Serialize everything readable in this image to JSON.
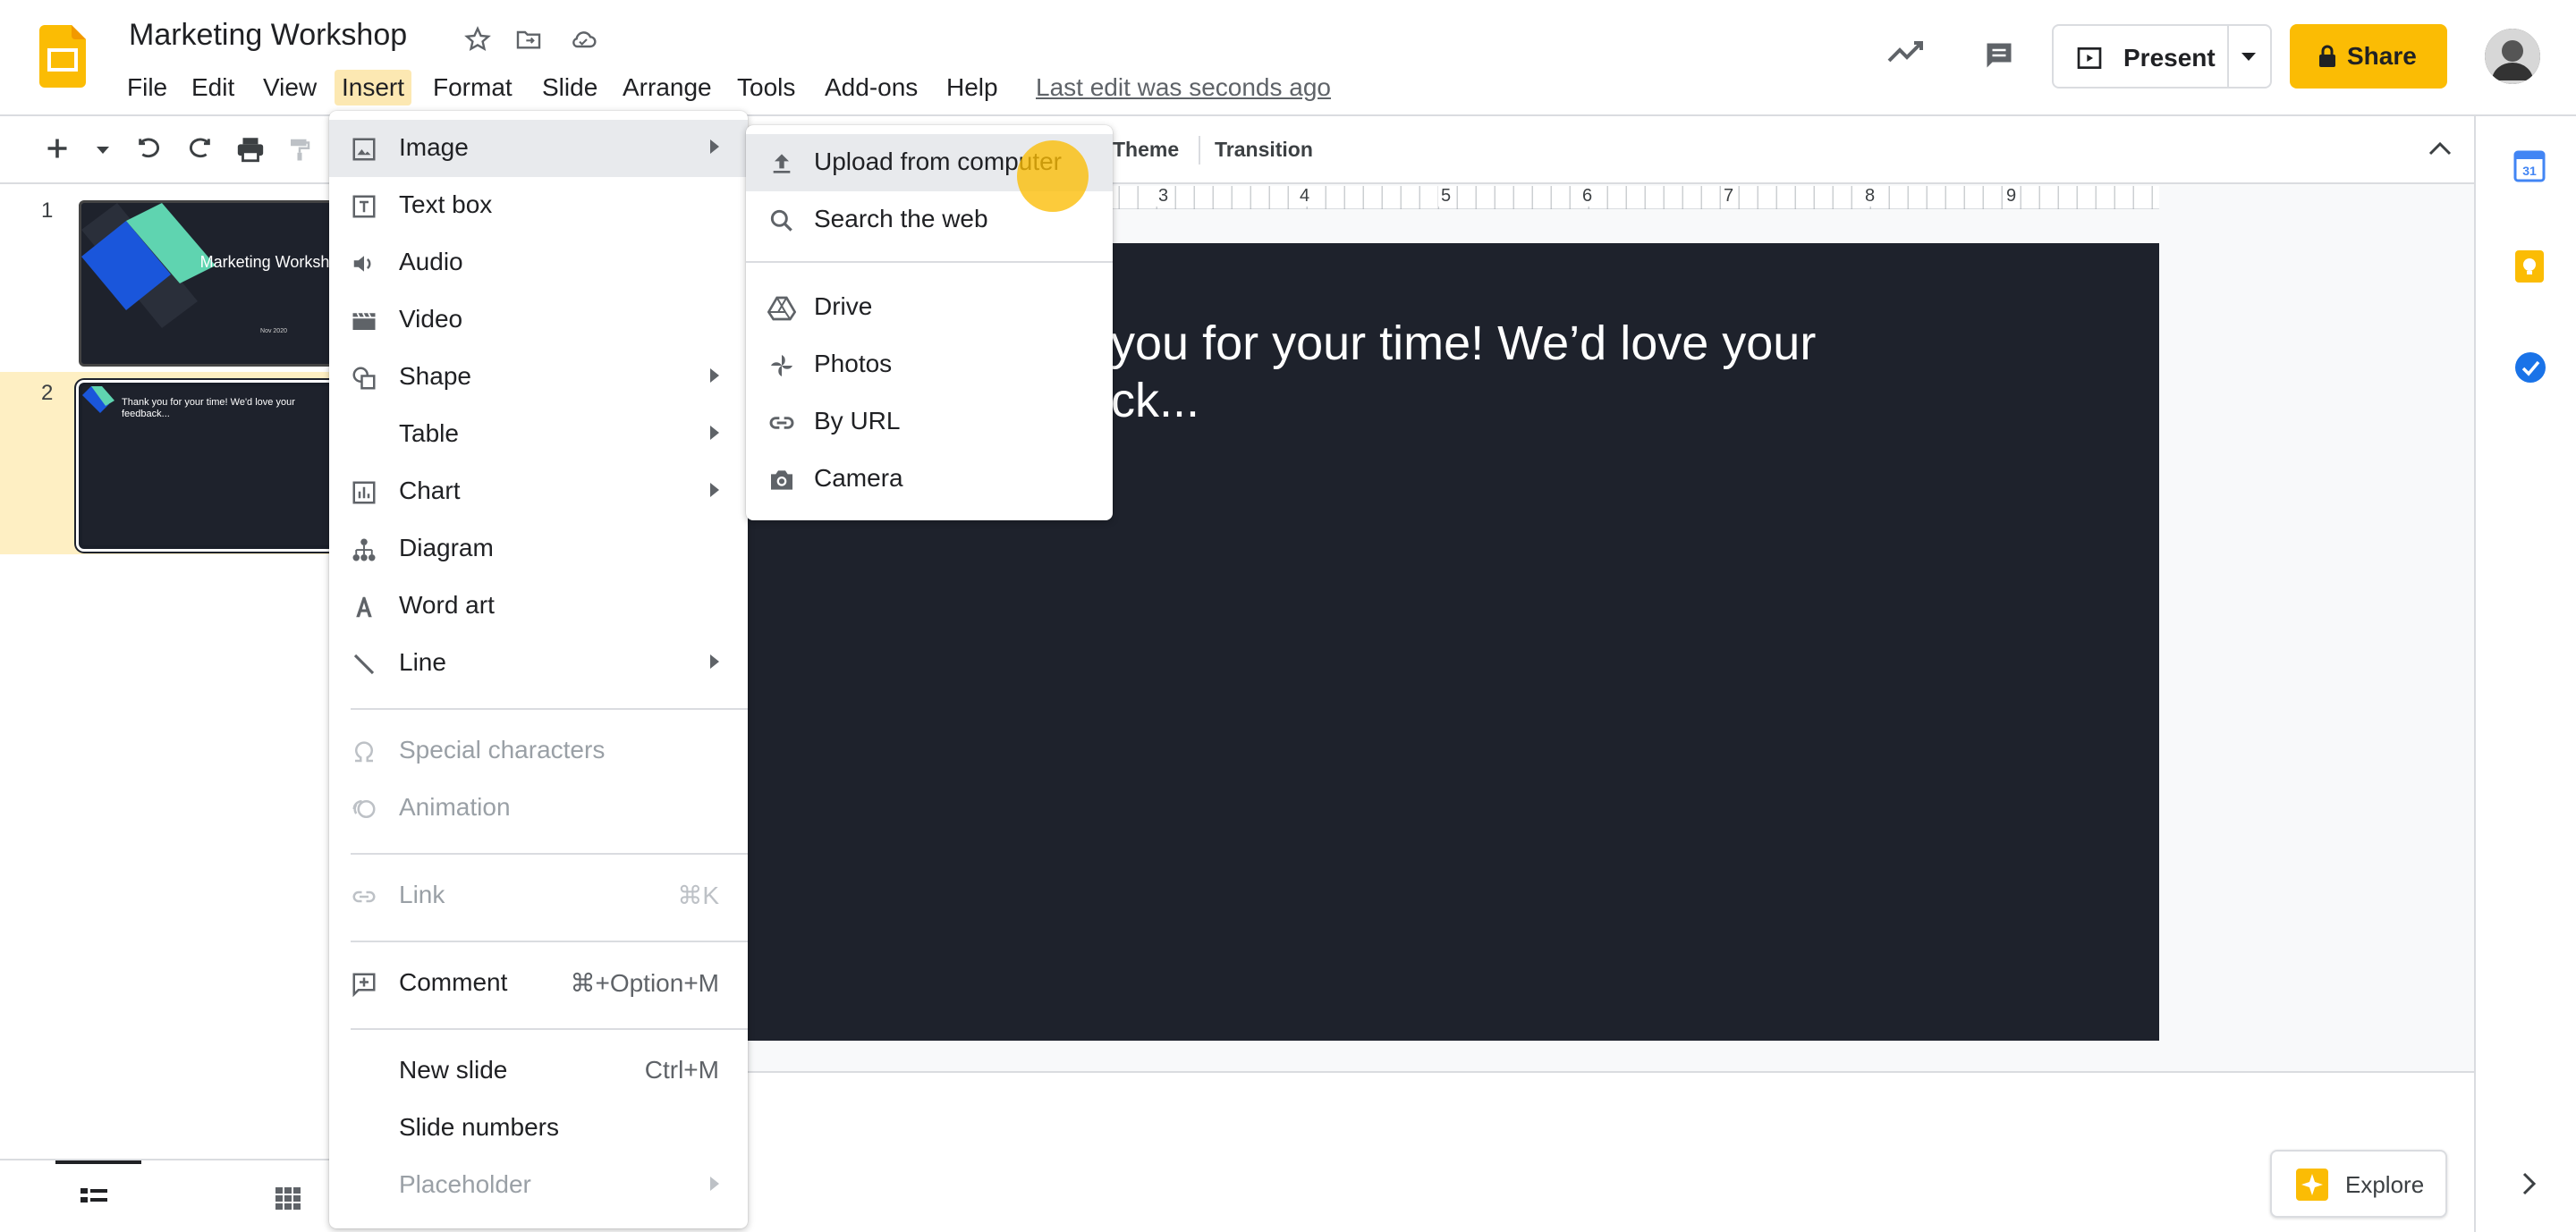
{
  "app": {
    "doc_title": "Marketing Workshop",
    "last_edit": "Last edit was seconds ago",
    "menu": [
      "File",
      "Edit",
      "View",
      "Insert",
      "Format",
      "Slide",
      "Arrange",
      "Tools",
      "Add-ons",
      "Help"
    ],
    "present_label": "Present",
    "share_label": "Share",
    "explore_label": "Explore",
    "brand_color": "#fbbc04"
  },
  "toolbar": {
    "theme_label": "Theme",
    "transition_label": "Transition"
  },
  "ruler": {
    "ticks": [
      "3",
      "4",
      "5",
      "6",
      "7",
      "8",
      "9"
    ]
  },
  "filmstrip": {
    "slides": [
      {
        "number": "1",
        "title": "Marketing Workshop",
        "date": "Nov 2020"
      },
      {
        "number": "2",
        "text": "Thank you for your time! We'd love your feedback..."
      }
    ]
  },
  "slide": {
    "text_line1": "you for your time! We’d love your",
    "text_line2": "ck..."
  },
  "insert_menu": {
    "items": [
      {
        "label": "Image",
        "icon": "image-icon",
        "submenu": true
      },
      {
        "label": "Text box",
        "icon": "text-box-icon"
      },
      {
        "label": "Audio",
        "icon": "audio-icon"
      },
      {
        "label": "Video",
        "icon": "video-icon"
      },
      {
        "label": "Shape",
        "icon": "shape-icon",
        "submenu": true
      },
      {
        "label": "Table",
        "submenu": true
      },
      {
        "label": "Chart",
        "icon": "chart-icon",
        "submenu": true
      },
      {
        "label": "Diagram",
        "icon": "diagram-icon"
      },
      {
        "label": "Word art",
        "icon": "word-art-icon"
      },
      {
        "label": "Line",
        "icon": "line-icon",
        "submenu": true
      },
      {
        "label": "Special characters",
        "icon": "omega-icon",
        "disabled": true
      },
      {
        "label": "Animation",
        "icon": "animation-icon",
        "disabled": true
      },
      {
        "label": "Link",
        "icon": "link-icon",
        "shortcut": "⌘K",
        "disabled": true
      },
      {
        "label": "Comment",
        "icon": "comment-icon",
        "shortcut": "⌘+Option+M"
      },
      {
        "label": "New slide",
        "shortcut": "Ctrl+M"
      },
      {
        "label": "Slide numbers"
      },
      {
        "label": "Placeholder",
        "submenu": true,
        "disabled": true
      }
    ]
  },
  "image_submenu": {
    "items": [
      {
        "label": "Upload from computer",
        "icon": "upload-icon"
      },
      {
        "label": "Search the web",
        "icon": "search-icon"
      },
      {
        "label": "Drive",
        "icon": "drive-icon"
      },
      {
        "label": "Photos",
        "icon": "photos-icon"
      },
      {
        "label": "By URL",
        "icon": "link-icon"
      },
      {
        "label": "Camera",
        "icon": "camera-icon"
      }
    ]
  }
}
